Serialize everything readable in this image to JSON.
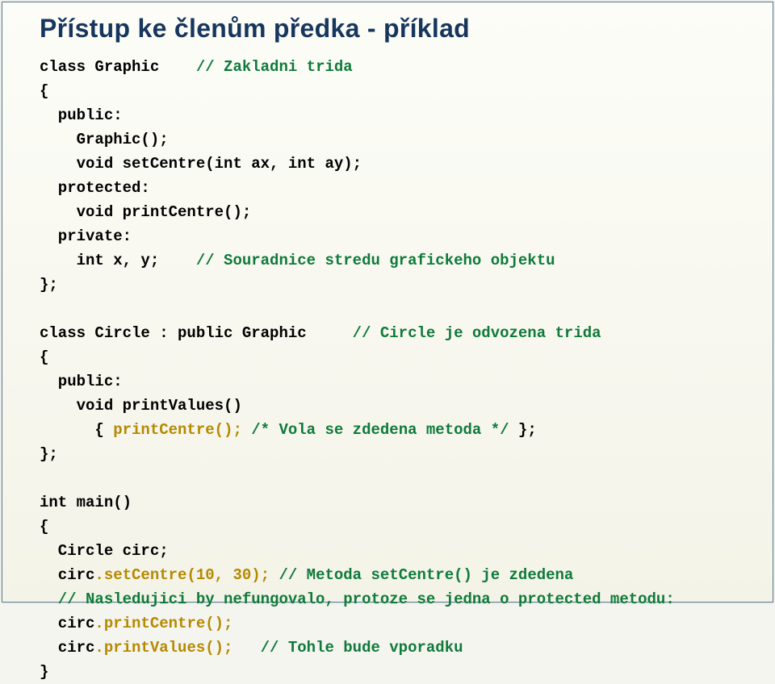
{
  "title": "Přístup ke členům předka - příklad",
  "gk": "class Graphic",
  "gc": "// Zakladni trida",
  "br1": "{",
  "pub": "  public:",
  "gctor": "    Graphic();",
  "vsc": "    void setCentre(int ax, int ay);",
  "prot": "  protected:",
  "vpc": "    void printCentre();",
  "priv": "  private:",
  "ixy": "    int x, y;",
  "cxy": "// Souradnice stredu grafickeho objektu",
  "br2": "};",
  "ck": "class Circle : public Graphic",
  "cc": "// Circle je odvozena trida",
  "br3": "{",
  "pub2": "  public:",
  "vpv": "    void printValues()",
  "callpc1": "      { ",
  "callpc2": "printCentre();",
  "callpc3": " /* Vola se zdedena metoda */ ",
  "callpc4": "};",
  "br4": "};",
  "imain": "int main()",
  "br5": "{",
  "circdecl": "  Circle circ;",
  "circ1a": "  circ",
  "circ1b": ".setCentre(10, 30);",
  "circ1c": " // Metoda setCentre() je zdedena",
  "circ2": "  // Nasledujici by nefungovalo, protoze se jedna o protected metodu:",
  "circ3a": "  circ",
  "circ3b": ".printCentre();",
  "circ4a": "  circ",
  "circ4b": ".printValues();",
  "circ4c": "   // Tohle bude vporadku",
  "br6": "}"
}
